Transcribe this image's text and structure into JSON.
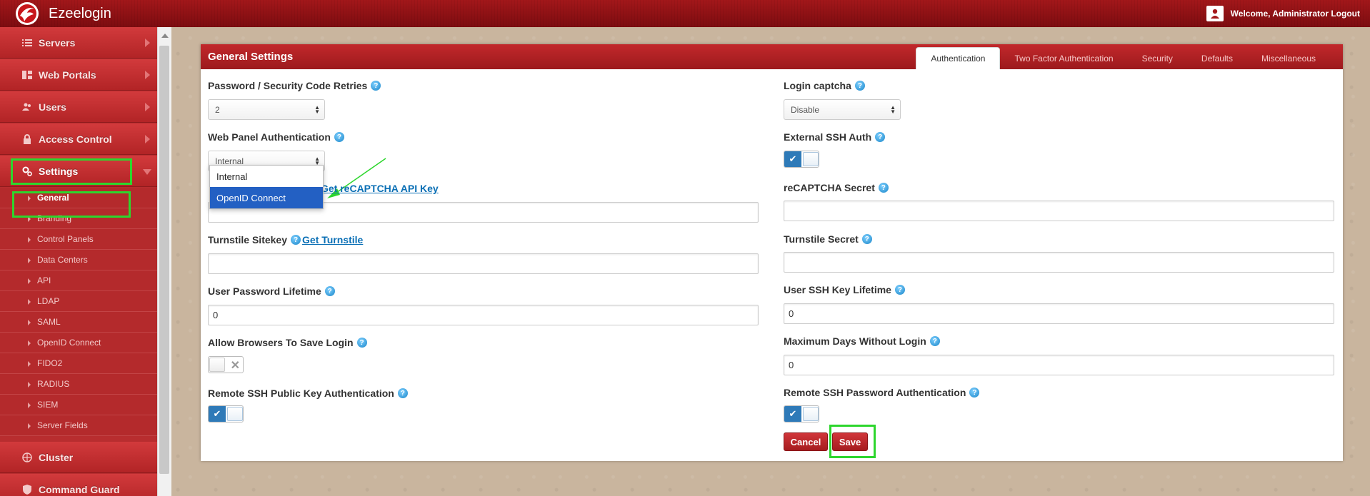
{
  "app": {
    "title": "Ezeelogin",
    "welcome": "Welcome, Administrator Logout"
  },
  "sidebar": {
    "items": [
      {
        "label": "Servers",
        "icon": "list-icon"
      },
      {
        "label": "Web Portals",
        "icon": "dashboard-icon"
      },
      {
        "label": "Users",
        "icon": "users-icon"
      },
      {
        "label": "Access Control",
        "icon": "lock-icon"
      },
      {
        "label": "Settings",
        "icon": "gears-icon"
      }
    ],
    "submenu": [
      "General",
      "Branding",
      "Control Panels",
      "Data Centers",
      "API",
      "LDAP",
      "SAML",
      "OpenID Connect",
      "FIDO2",
      "RADIUS",
      "SIEM",
      "Server Fields"
    ],
    "after": [
      {
        "label": "Cluster",
        "icon": "cluster-icon"
      },
      {
        "label": "Command Guard",
        "icon": "shield-icon"
      }
    ]
  },
  "panel": {
    "title": "General Settings",
    "tabs": [
      "Authentication",
      "Two Factor Authentication",
      "Security",
      "Defaults",
      "Miscellaneous"
    ]
  },
  "form": {
    "password_retries": {
      "label": "Password / Security Code Retries",
      "value": "2"
    },
    "login_captcha": {
      "label": "Login captcha",
      "value": "Disable"
    },
    "web_panel_auth": {
      "label": "Web Panel Authentication",
      "value": "Internal",
      "options": [
        "Internal",
        "OpenID Connect"
      ]
    },
    "external_ssh_auth": {
      "label": "External SSH Auth"
    },
    "recaptcha_key": {
      "link": "Get reCAPTCHA API Key"
    },
    "recaptcha_secret": {
      "label": "reCAPTCHA Secret"
    },
    "turnstile_sitekey": {
      "label": "Turnstile Sitekey",
      "link": "Get Turnstile"
    },
    "turnstile_secret": {
      "label": "Turnstile Secret"
    },
    "user_password_lifetime": {
      "label": "User Password Lifetime",
      "value": "0"
    },
    "user_ssh_key_lifetime": {
      "label": "User SSH Key Lifetime",
      "value": "0"
    },
    "allow_browsers_save": {
      "label": "Allow Browsers To Save Login"
    },
    "max_days_without_login": {
      "label": "Maximum Days Without Login",
      "value": "0"
    },
    "remote_ssh_pubkey": {
      "label": "Remote SSH Public Key Authentication"
    },
    "remote_ssh_password": {
      "label": "Remote SSH Password Authentication"
    }
  },
  "buttons": {
    "cancel": "Cancel",
    "save": "Save"
  },
  "colors": {
    "accent": "#b82d2f",
    "highlight": "#2dd62d",
    "toggle_on": "#2e7ab8",
    "select_hl": "#2360c3"
  }
}
